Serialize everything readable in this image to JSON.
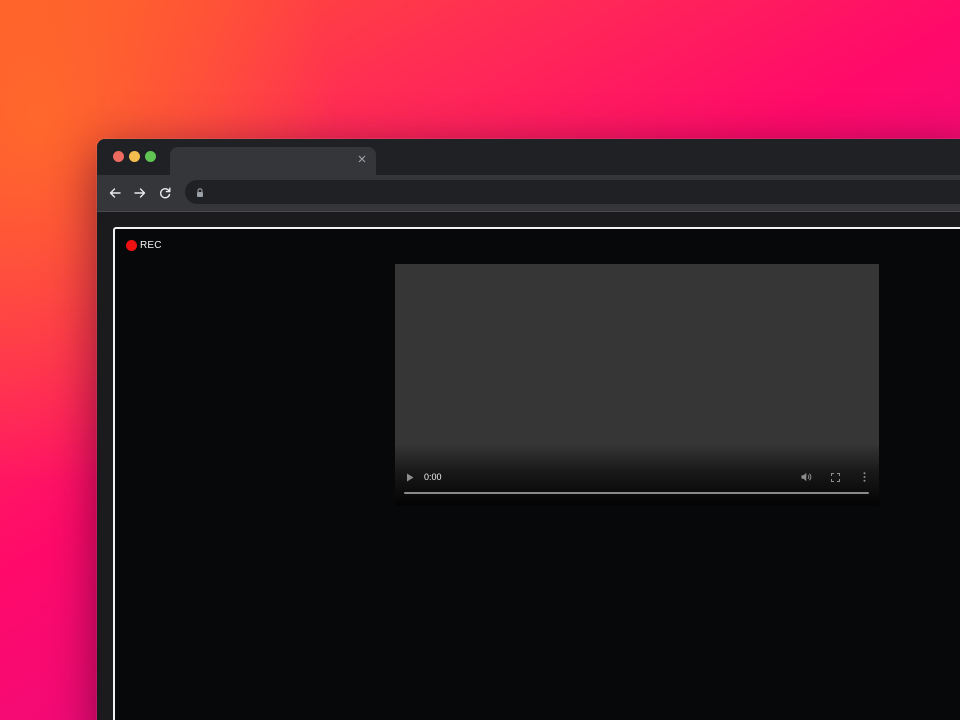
{
  "window": {
    "tab_title": "",
    "address": ""
  },
  "recording": {
    "label": "REC",
    "indicator_color": "#ee1111"
  },
  "video": {
    "current_time": "0:00",
    "progress": 0
  },
  "icons": {
    "tab_close": "close-icon",
    "back": "arrow-left-icon",
    "forward": "arrow-right-icon",
    "reload": "reload-icon",
    "lock": "lock-icon",
    "play": "play-icon",
    "volume": "volume-icon",
    "fullscreen": "fullscreen-icon",
    "more": "more-vertical-icon"
  },
  "colors": {
    "chrome_dark": "#202124",
    "toolbar": "#35363a",
    "stage_border": "#f2f2f2",
    "stage_background": "#07080a",
    "video_background": "#363636"
  }
}
